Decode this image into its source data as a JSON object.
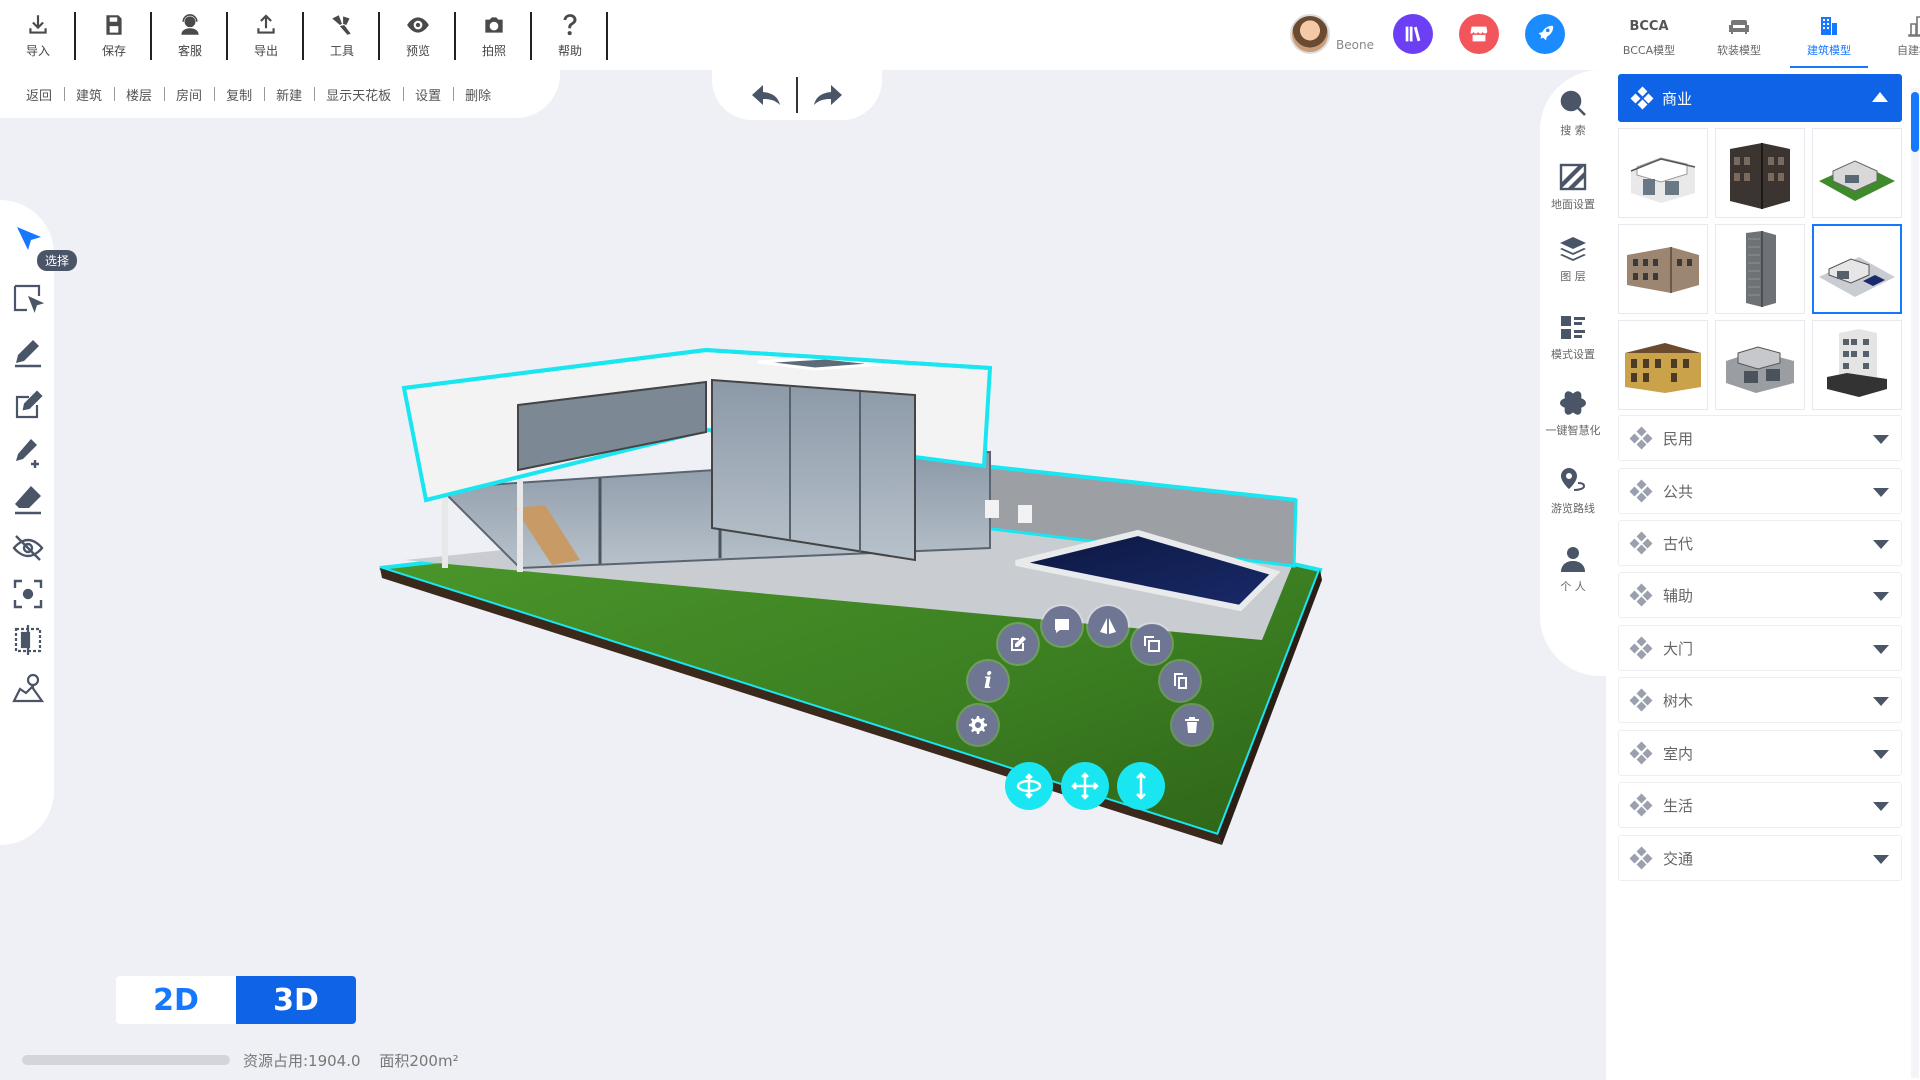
{
  "toolbar": {
    "items": [
      {
        "label": "导入",
        "icon": "import-icon"
      },
      {
        "label": "保存",
        "icon": "save-icon"
      },
      {
        "label": "客服",
        "icon": "customer-service-icon"
      },
      {
        "label": "导出",
        "icon": "export-icon"
      },
      {
        "label": "工具",
        "icon": "tools-icon"
      },
      {
        "label": "预览",
        "icon": "eye-icon"
      },
      {
        "label": "拍照",
        "icon": "camera-icon"
      },
      {
        "label": "帮助",
        "icon": "question-icon"
      }
    ]
  },
  "user": {
    "name": "Beone",
    "buttons": [
      {
        "icon": "library-icon",
        "color": "#6c3ff5"
      },
      {
        "icon": "store-icon",
        "color": "#f2555a"
      },
      {
        "icon": "rocket-icon",
        "color": "#1a8cff"
      }
    ]
  },
  "model_tabs": [
    {
      "label": "BCCA模型",
      "icon_text": "BCCA",
      "active": false
    },
    {
      "label": "软装模型",
      "icon": "sofa-icon",
      "active": false
    },
    {
      "label": "建筑模型",
      "icon": "building-icon",
      "active": true
    },
    {
      "label": "自建模型",
      "icon": "custom-building-icon",
      "active": false
    }
  ],
  "submenu": [
    "返回",
    "建筑",
    "楼层",
    "房间",
    "复制",
    "新建",
    "显示天花板",
    "设置",
    "删除"
  ],
  "undo_redo": {
    "undo_icon": "undo-icon",
    "redo_icon": "redo-icon"
  },
  "left_tools": {
    "tooltip": "选择",
    "items": [
      "select-arrow-icon",
      "box-select-icon",
      "pen-icon",
      "edit-box-icon",
      "pen-plus-icon",
      "eraser-icon",
      "hide-icon",
      "focus-icon",
      "mirror-icon",
      "map-pin-icon"
    ]
  },
  "right_icons": [
    {
      "label": "搜 索",
      "icon": "search-icon"
    },
    {
      "label": "地面设置",
      "icon": "floor-settings-icon"
    },
    {
      "label": "图 层",
      "icon": "layers-icon"
    },
    {
      "label": "模式设置",
      "icon": "mode-settings-icon"
    },
    {
      "label": "一键智慧化",
      "icon": "atom-icon"
    },
    {
      "label": "游览路线",
      "icon": "route-icon"
    },
    {
      "label": "个 人",
      "icon": "person-icon"
    }
  ],
  "panel": {
    "expanded_category": "商业",
    "thumbnails": [
      {
        "name": "modern-villa-white",
        "selected": false
      },
      {
        "name": "dark-brick-building",
        "selected": false
      },
      {
        "name": "villa-with-lawn",
        "selected": false
      },
      {
        "name": "brick-apartment",
        "selected": false
      },
      {
        "name": "grey-tower",
        "selected": false
      },
      {
        "name": "villa-with-pool",
        "selected": true
      },
      {
        "name": "yellow-facade",
        "selected": false
      },
      {
        "name": "grey-modern-house",
        "selected": false
      },
      {
        "name": "white-office-block",
        "selected": false
      }
    ],
    "categories": [
      "民用",
      "公共",
      "古代",
      "辅助",
      "大门",
      "树木",
      "室内",
      "生活",
      "交通"
    ]
  },
  "action_ring": [
    "edit-icon",
    "comment-icon",
    "mirror-flip-icon",
    "clone-icon",
    "info-icon",
    "copy-icon",
    "settings-icon",
    "delete-icon"
  ],
  "move_buttons": [
    "rotate-icon",
    "move-icon",
    "vertical-move-icon"
  ],
  "view_toggle": {
    "two_d": "2D",
    "three_d": "3D",
    "active": "3D"
  },
  "status": {
    "resource": "资源占用:1904.0",
    "area_label": "面积200m²"
  },
  "colors": {
    "accent": "#1677ff",
    "selection_outline": "#19e6f0",
    "panel_active": "#0f63e6"
  }
}
